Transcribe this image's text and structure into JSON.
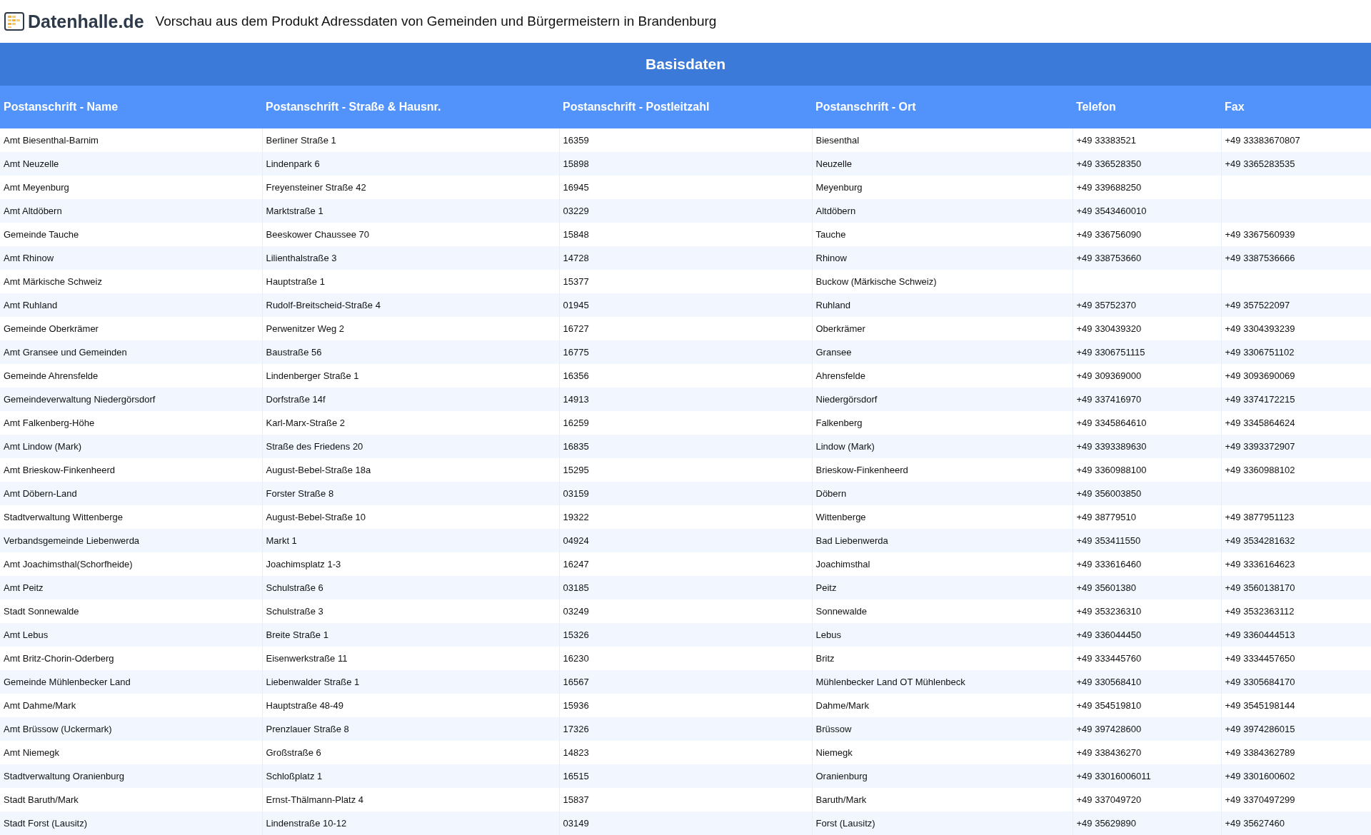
{
  "header": {
    "logo_text": "Datenhalle.de",
    "title": "Vorschau aus dem Produkt Adressdaten von Gemeinden und Bürgermeistern in Brandenburg"
  },
  "section_title": "Basisdaten",
  "table": {
    "columns": [
      "Postanschrift - Name",
      "Postanschrift - Straße & Hausnr.",
      "Postanschrift - Postleitzahl",
      "Postanschrift - Ort",
      "Telefon",
      "Fax"
    ],
    "rows": [
      [
        "Amt Biesenthal-Barnim",
        "Berliner Straße 1",
        "16359",
        "Biesenthal",
        "+49 33383521",
        "+49 33383670807"
      ],
      [
        "Amt Neuzelle",
        "Lindenpark 6",
        "15898",
        "Neuzelle",
        "+49 336528350",
        "+49 3365283535"
      ],
      [
        "Amt Meyenburg",
        "Freyensteiner Straße 42",
        "16945",
        "Meyenburg",
        "+49 339688250",
        null
      ],
      [
        "Amt Altdöbern",
        "Marktstraße 1",
        "03229",
        "Altdöbern",
        "+49 3543460010",
        null
      ],
      [
        "Gemeinde Tauche",
        "Beeskower Chaussee 70",
        "15848",
        "Tauche",
        "+49 336756090",
        "+49 3367560939"
      ],
      [
        "Amt Rhinow",
        "Lilienthalstraße 3",
        "14728",
        "Rhinow",
        "+49 338753660",
        "+49 3387536666"
      ],
      [
        "Amt Märkische Schweiz",
        "Hauptstraße 1",
        "15377",
        "Buckow (Märkische Schweiz)",
        null,
        null
      ],
      [
        "Amt Ruhland",
        "Rudolf-Breitscheid-Straße 4",
        "01945",
        "Ruhland",
        "+49 35752370",
        "+49 357522097"
      ],
      [
        "Gemeinde Oberkrämer",
        "Perwenitzer Weg 2",
        "16727",
        "Oberkrämer",
        "+49 330439320",
        "+49 3304393239"
      ],
      [
        "Amt Gransee und Gemeinden",
        "Baustraße 56",
        "16775",
        "Gransee",
        "+49 3306751115",
        "+49 3306751102"
      ],
      [
        "Gemeinde Ahrensfelde",
        "Lindenberger Straße 1",
        "16356",
        "Ahrensfelde",
        "+49 309369000",
        "+49 3093690069"
      ],
      [
        "Gemeindeverwaltung Niedergörsdorf",
        "Dorfstraße 14f",
        "14913",
        "Niedergörsdorf",
        "+49 337416970",
        "+49 3374172215"
      ],
      [
        "Amt Falkenberg-Höhe",
        "Karl-Marx-Straße 2",
        "16259",
        "Falkenberg",
        "+49 3345864610",
        "+49 3345864624"
      ],
      [
        "Amt Lindow (Mark)",
        "Straße des Friedens 20",
        "16835",
        "Lindow (Mark)",
        "+49 3393389630",
        "+49 3393372907"
      ],
      [
        "Amt Brieskow-Finkenheerd",
        "August-Bebel-Straße 18a",
        "15295",
        "Brieskow-Finkenheerd",
        "+49 3360988100",
        "+49 3360988102"
      ],
      [
        "Amt Döbern-Land",
        "Forster Straße 8",
        "03159",
        "Döbern",
        "+49 356003850",
        null
      ],
      [
        "Stadtverwaltung Wittenberge",
        "August-Bebel-Straße 10",
        "19322",
        "Wittenberge",
        "+49 38779510",
        "+49 3877951123"
      ],
      [
        "Verbandsgemeinde Liebenwerda",
        "Markt 1",
        "04924",
        "Bad Liebenwerda",
        "+49 353411550",
        "+49 3534281632"
      ],
      [
        "Amt Joachimsthal(Schorfheide)",
        "Joachimsplatz 1-3",
        "16247",
        "Joachimsthal",
        "+49 333616460",
        "+49 3336164623"
      ],
      [
        "Amt Peitz",
        "Schulstraße 6",
        "03185",
        "Peitz",
        "+49 35601380",
        "+49 3560138170"
      ],
      [
        "Stadt Sonnewalde",
        "Schulstraße 3",
        "03249",
        "Sonnewalde",
        "+49 353236310",
        "+49 3532363112"
      ],
      [
        "Amt Lebus",
        "Breite Straße 1",
        "15326",
        "Lebus",
        "+49 336044450",
        "+49 3360444513"
      ],
      [
        "Amt Britz-Chorin-Oderberg",
        "Eisenwerkstraße 11",
        "16230",
        "Britz",
        "+49 333445760",
        "+49 3334457650"
      ],
      [
        "Gemeinde Mühlenbecker Land",
        "Liebenwalder Straße 1",
        "16567",
        "Mühlenbecker Land OT Mühlenbeck",
        "+49 330568410",
        "+49 3305684170"
      ],
      [
        "Amt Dahme/Mark",
        "Hauptstraße 48-49",
        "15936",
        "Dahme/Mark",
        "+49 354519810",
        "+49 3545198144"
      ],
      [
        "Amt Brüssow (Uckermark)",
        "Prenzlauer Straße 8",
        "17326",
        "Brüssow",
        "+49 397428600",
        "+49 3974286015"
      ],
      [
        "Amt Niemegk",
        "Großstraße 6",
        "14823",
        "Niemegk",
        "+49 338436270",
        "+49 3384362789"
      ],
      [
        "Stadtverwaltung Oranienburg",
        "Schloßplatz 1",
        "16515",
        "Oranienburg",
        "+49 33016006011",
        "+49 3301600602"
      ],
      [
        "Stadt Baruth/Mark",
        "Ernst-Thälmann-Platz 4",
        "15837",
        "Baruth/Mark",
        "+49 337049720",
        "+49 3370497299"
      ],
      [
        "Stadt Forst (Lausitz)",
        "Lindenstraße 10-12",
        "03149",
        "Forst (Lausitz)",
        "+49 35629890",
        "+49 35627460"
      ]
    ]
  }
}
